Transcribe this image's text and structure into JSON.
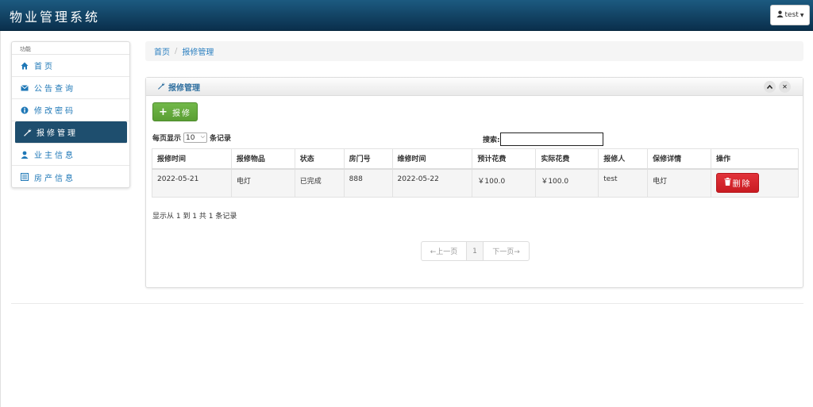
{
  "app": {
    "title": "物业管理系统"
  },
  "user_menu": {
    "label": "test",
    "icon": "user-icon"
  },
  "sidebar": {
    "header": "功能",
    "items": [
      {
        "label": "首页",
        "icon": "home-icon"
      },
      {
        "label": "公告查询",
        "icon": "envelope-icon"
      },
      {
        "label": "修改密码",
        "icon": "info-icon"
      },
      {
        "label": "报修管理",
        "icon": "wrench-icon",
        "active": true
      },
      {
        "label": "业主信息",
        "icon": "user-icon"
      },
      {
        "label": "房产信息",
        "icon": "list-icon"
      }
    ]
  },
  "breadcrumb": {
    "home": "首页",
    "current": "报修管理"
  },
  "panel": {
    "title": "报修管理",
    "add_button": "报修",
    "length_prefix": "每页显示",
    "length_value": "10",
    "length_suffix": "条记录",
    "search_label": "搜索:",
    "search_value": "",
    "columns": [
      "报修时间",
      "报修物品",
      "状态",
      "房门号",
      "维修时间",
      "预计花费",
      "实际花费",
      "报修人",
      "保修详情",
      "操作"
    ],
    "rows": [
      [
        "2022-05-21",
        "电灯",
        "已完成",
        "888",
        "2022-05-22",
        "￥100.0",
        "￥100.0",
        "test",
        "电灯",
        "删除"
      ]
    ],
    "info": "显示从 1 到 1 共 1 条记录",
    "pager": {
      "prev": "←上一页",
      "page": "1",
      "next": "下一页→"
    }
  },
  "colors": {
    "topbar": "#0a2f4c",
    "active_nav": "#1e4e6e",
    "add_button": "#62a83a",
    "delete_button": "#d0262c",
    "link": "#2a7fc0"
  }
}
